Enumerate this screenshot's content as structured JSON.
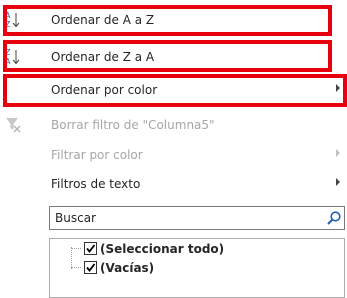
{
  "menu": {
    "sort_az": "Ordenar de A a Z",
    "sort_za": "Ordenar de Z a A",
    "sort_color": "Ordenar por color",
    "clear_filter": "Borrar filtro de \"Columna5\"",
    "filter_color": "Filtrar por color",
    "text_filters": "Filtros de texto"
  },
  "search": {
    "placeholder": "Buscar"
  },
  "list": {
    "select_all": "(Seleccionar todo)",
    "empty": "(Vacías)"
  },
  "colors": {
    "highlight": "#e8000e",
    "sort_icon_blue": "#1f5fb5"
  },
  "icons": {
    "sort_az": "sort-ascending-icon",
    "sort_za": "sort-descending-icon",
    "clear_filter": "clear-filter-icon",
    "search": "search-icon"
  }
}
